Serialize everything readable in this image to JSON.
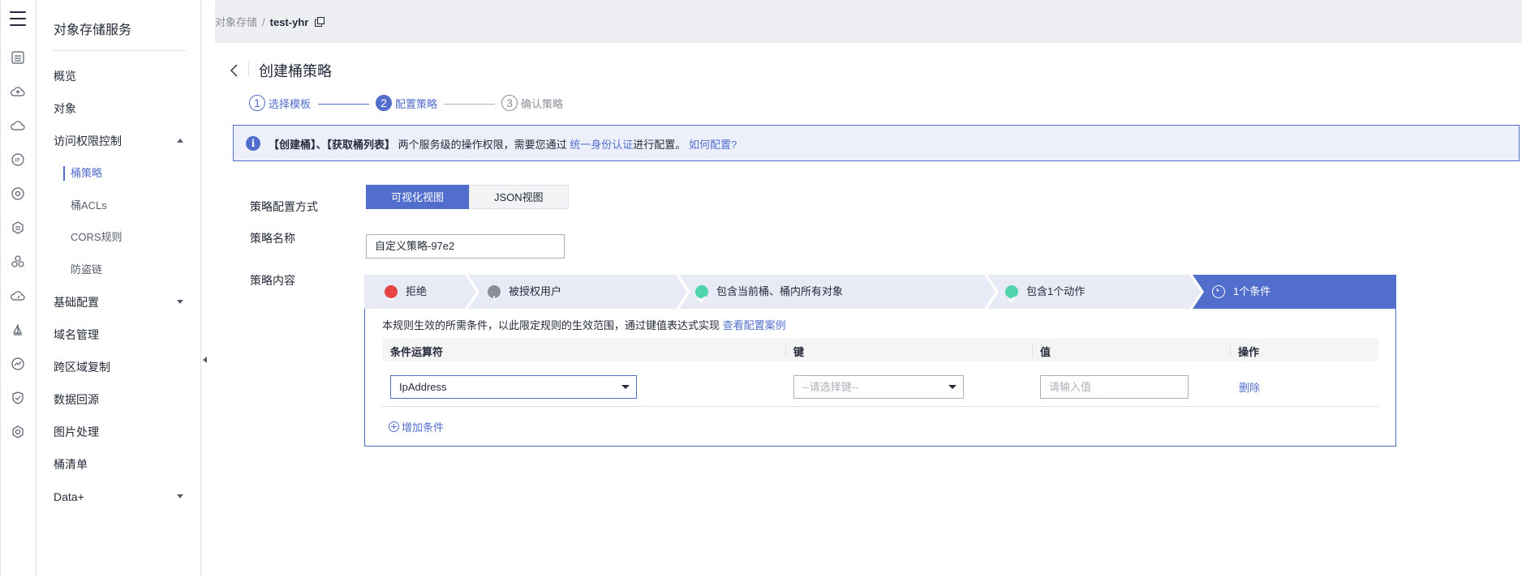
{
  "sidebar": {
    "title": "对象存储服务",
    "items": [
      {
        "label": "概览"
      },
      {
        "label": "对象"
      },
      {
        "label": "访问权限控制"
      },
      {
        "label": "桶策略"
      },
      {
        "label": "桶ACLs"
      },
      {
        "label": "CORS规则"
      },
      {
        "label": "防盗链"
      },
      {
        "label": "基础配置"
      },
      {
        "label": "域名管理"
      },
      {
        "label": "跨区域复制"
      },
      {
        "label": "数据回源"
      },
      {
        "label": "图片处理"
      },
      {
        "label": "桶清单"
      },
      {
        "label": "Data+"
      }
    ]
  },
  "breadcrumb": {
    "root": "对象存储",
    "separator": "/",
    "current": "test-yhr"
  },
  "page": {
    "title": "创建桶策略"
  },
  "steps": [
    {
      "num": "1",
      "label": "选择模板"
    },
    {
      "num": "2",
      "label": "配置策略"
    },
    {
      "num": "3",
      "label": "确认策略"
    }
  ],
  "alert": {
    "bold": "【创建桶】、【获取桶列表】",
    "text1": "两个服务级的操作权限，需要您通过",
    "link1": "统一身份认证",
    "text2": "进行配置。",
    "link2": "如何配置?"
  },
  "form": {
    "mode_label": "策略配置方式",
    "mode_visual": "可视化视图",
    "mode_json": "JSON视图",
    "name_label": "策略名称",
    "name_value": "自定义策略-97e2",
    "content_label": "策略内容"
  },
  "policy_tabs": [
    {
      "label": "拒绝"
    },
    {
      "label": "被授权用户"
    },
    {
      "label": "包含当前桶、桶内所有对象"
    },
    {
      "label": "包含1个动作"
    },
    {
      "label": "1个条件"
    }
  ],
  "conditions": {
    "desc": "本规则生效的所需条件，以此限定规则的生效范围，通过键值表达式实现",
    "desc_link": "查看配置案例",
    "headers": [
      "条件运算符",
      "键",
      "值",
      "操作"
    ],
    "operator_value": "IpAddress",
    "key_placeholder": "--请选择键--",
    "value_placeholder": "请输入值",
    "delete_label": "删除",
    "add_label": "增加条件"
  },
  "colors": {
    "accent": "#526ecc",
    "deny": "#e54545",
    "ok": "#50d4ab",
    "gray": "#8a8e99"
  }
}
